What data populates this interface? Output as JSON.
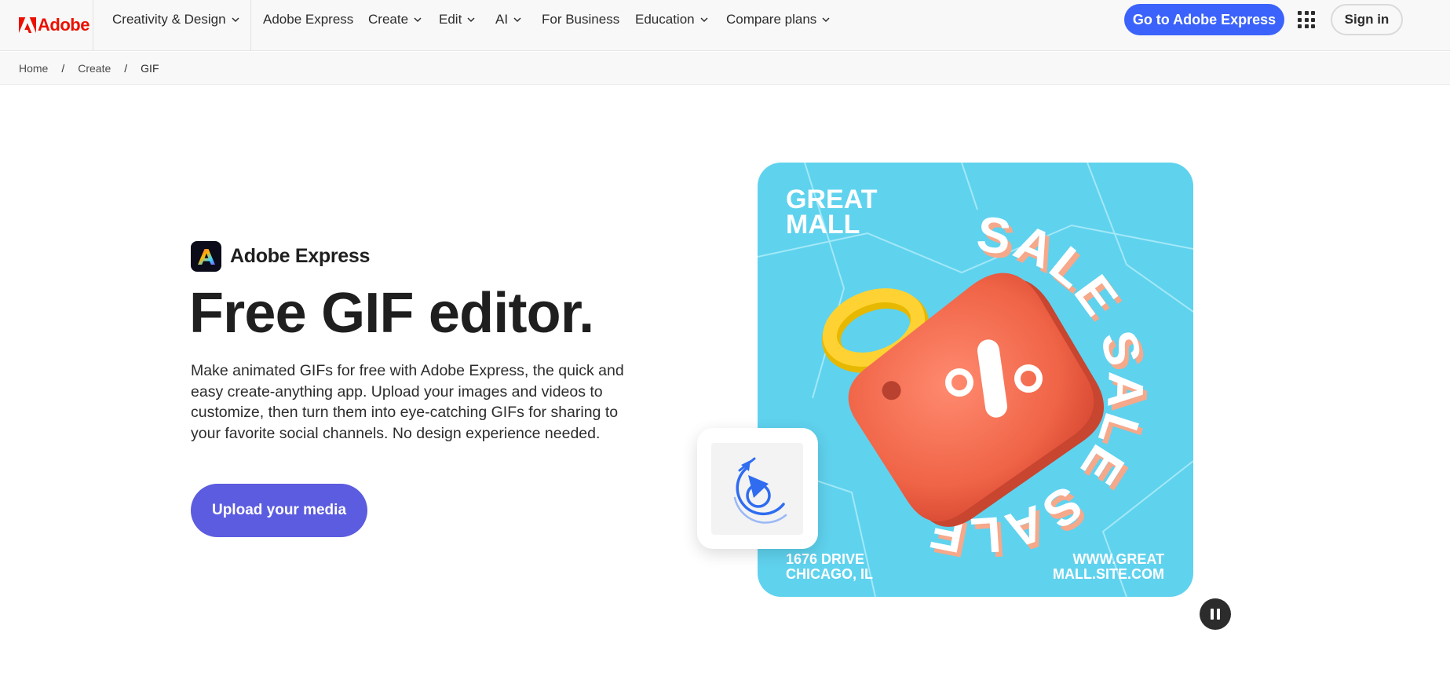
{
  "header": {
    "brand": "Adobe",
    "nav": [
      {
        "label": "Creativity & Design",
        "has_menu": true
      },
      {
        "label": "Adobe Express",
        "has_menu": false
      },
      {
        "label": "Create",
        "has_menu": true
      },
      {
        "label": "Edit",
        "has_menu": true
      },
      {
        "label": "AI",
        "has_menu": true
      },
      {
        "label": "For Business",
        "has_menu": false
      },
      {
        "label": "Education",
        "has_menu": true
      },
      {
        "label": "Compare plans",
        "has_menu": true
      }
    ],
    "cta_label": "Go to Adobe Express",
    "signin_label": "Sign in",
    "apps_icon": "grid-icon"
  },
  "breadcrumb": {
    "items": [
      "Home",
      "Create",
      "GIF"
    ],
    "separator": "/"
  },
  "hero": {
    "product_name": "Adobe Express",
    "title": "Free GIF editor.",
    "description": "Make animated GIFs for free with Adobe Express, the quick and easy create-anything app. Upload your images and videos to customize, then turn them into eye-catching GIFs for sharing to your favorite social channels. No design experience needed.",
    "upload_label": "Upload your media"
  },
  "poster": {
    "brand_line1": "GREAT",
    "brand_line2": "MALL",
    "ring_word": "SALE",
    "tag_symbol": "%",
    "address_line1": "1676 DRIVE",
    "address_line2": "CHICAGO, IL",
    "site_line1": "WWW.GREAT",
    "site_line2": "MALL.SITE.COM"
  },
  "colors": {
    "adobe_red": "#eb1000",
    "cta_blue": "#3b63fb",
    "upload_purple": "#5c5ce0",
    "poster_cyan": "#5fd2ee",
    "tag_coral": "#f27056",
    "ring_yellow": "#ffd233"
  },
  "icons": {
    "media_card": "animate-loop-icon",
    "pause": "pause-icon"
  }
}
